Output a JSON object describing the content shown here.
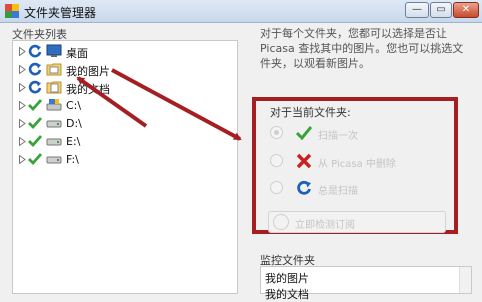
{
  "window": {
    "title": "文件夹管理器"
  },
  "window_buttons": {
    "minimize": "—",
    "maximize": "▭",
    "close": "✕"
  },
  "tree": {
    "label": "文件夹列表",
    "items": [
      {
        "label": "桌面",
        "status": "refresh",
        "icon": "desktop-icon"
      },
      {
        "label": "我的图片",
        "status": "refresh",
        "icon": "pictures-folder-icon"
      },
      {
        "label": "我的文档",
        "status": "refresh",
        "icon": "documents-folder-icon"
      },
      {
        "label": "C:\\",
        "status": "check",
        "icon": "drive-icon"
      },
      {
        "label": "D:\\",
        "status": "check",
        "icon": "drive-icon"
      },
      {
        "label": "E:\\",
        "status": "check",
        "icon": "drive-icon"
      },
      {
        "label": "F:\\",
        "status": "check",
        "icon": "drive-icon"
      }
    ]
  },
  "description": "对于每个文件夹，您都可以选择是否让 Picasa 查找其中的图片。您也可以挑选文件夹，以观看新图片。",
  "current_folder": {
    "label": "对于当前文件夹:",
    "options": [
      {
        "label": "扫描一次",
        "icon": "check-icon",
        "selected": true
      },
      {
        "label": "从 Picasa 中删除",
        "icon": "remove-icon",
        "selected": false
      },
      {
        "label": "总是扫描",
        "icon": "refresh-icon",
        "selected": false
      }
    ],
    "scan_button": "立即检测订阅"
  },
  "watched": {
    "label": "监控文件夹",
    "items": [
      "我的图片",
      "我的文档"
    ]
  },
  "colors": {
    "highlight": "#a51f22",
    "check": "#3aa23a",
    "refresh": "#1f5fb8",
    "remove": "#cc2020"
  }
}
